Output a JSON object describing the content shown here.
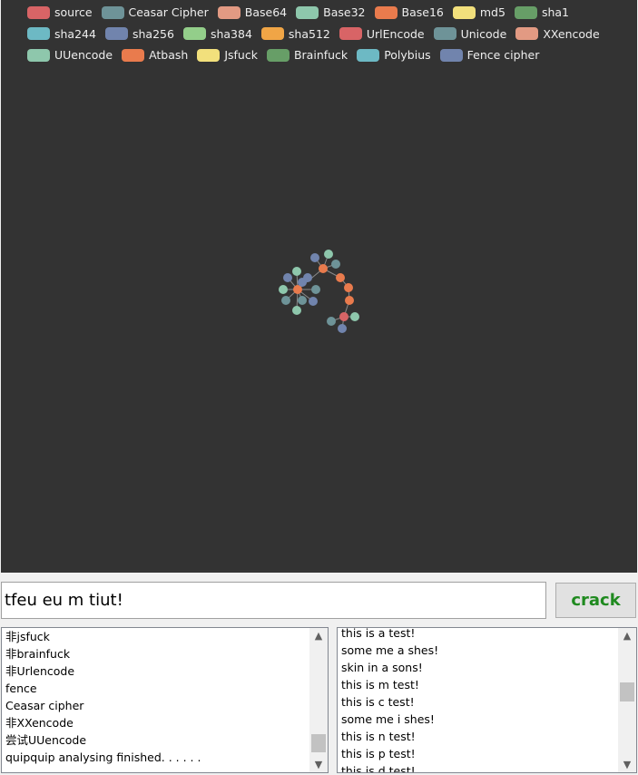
{
  "legend": [
    {
      "label": "source",
      "color": "#d86466"
    },
    {
      "label": "Ceasar Cipher",
      "color": "#6e9398"
    },
    {
      "label": "Base64",
      "color": "#e29a83"
    },
    {
      "label": "Base32",
      "color": "#8ec7ac"
    },
    {
      "label": "Base16",
      "color": "#e97b4d"
    },
    {
      "label": "md5",
      "color": "#f2e07c"
    },
    {
      "label": "sha1",
      "color": "#679e67"
    },
    {
      "label": "sha244",
      "color": "#6db9c4"
    },
    {
      "label": "sha256",
      "color": "#7184ad"
    },
    {
      "label": "sha384",
      "color": "#93ce8a"
    },
    {
      "label": "sha512",
      "color": "#f0a546"
    },
    {
      "label": "UrlEncode",
      "color": "#d86466"
    },
    {
      "label": "Unicode",
      "color": "#6e9398"
    },
    {
      "label": "XXencode",
      "color": "#e29a83"
    },
    {
      "label": "UUencode",
      "color": "#8ec7ac"
    },
    {
      "label": "Atbash",
      "color": "#e97b4d"
    },
    {
      "label": "Jsfuck",
      "color": "#f2e07c"
    },
    {
      "label": "Brainfuck",
      "color": "#679e67"
    },
    {
      "label": "Polybius",
      "color": "#6db9c4"
    },
    {
      "label": "Fence cipher",
      "color": "#7184ad"
    }
  ],
  "graph": {
    "nodes": [
      {
        "id": "a0",
        "color": "#e97b4d"
      },
      {
        "id": "a1",
        "color": "#8ec7ac"
      },
      {
        "id": "a2",
        "color": "#7184ad"
      },
      {
        "id": "a3",
        "color": "#7184ad"
      },
      {
        "id": "a4",
        "color": "#8ec7ac"
      },
      {
        "id": "a5",
        "color": "#6e9398"
      },
      {
        "id": "a6",
        "color": "#8ec7ac"
      },
      {
        "id": "a7",
        "color": "#6e9398"
      },
      {
        "id": "a8",
        "color": "#7184ad"
      },
      {
        "id": "a9",
        "color": "#6e9398"
      },
      {
        "id": "a10",
        "color": "#7184ad"
      },
      {
        "id": "b0",
        "color": "#e97b4d"
      },
      {
        "id": "b1",
        "color": "#7184ad"
      },
      {
        "id": "b2",
        "color": "#8ec7ac"
      },
      {
        "id": "b3",
        "color": "#6e9398"
      },
      {
        "id": "b4",
        "color": "#e97b4d"
      },
      {
        "id": "b5",
        "color": "#e97b4d"
      },
      {
        "id": "b6",
        "color": "#e97b4d"
      },
      {
        "id": "c0",
        "color": "#d86466"
      },
      {
        "id": "c1",
        "color": "#8ec7ac"
      },
      {
        "id": "c2",
        "color": "#6e9398"
      },
      {
        "id": "c3",
        "color": "#7184ad"
      }
    ],
    "links": [
      [
        "a0",
        "a1"
      ],
      [
        "a0",
        "a2"
      ],
      [
        "a0",
        "a3"
      ],
      [
        "a0",
        "a4"
      ],
      [
        "a0",
        "a5"
      ],
      [
        "a0",
        "a6"
      ],
      [
        "a0",
        "a7"
      ],
      [
        "a0",
        "a8"
      ],
      [
        "a0",
        "a9"
      ],
      [
        "a0",
        "a10"
      ],
      [
        "a0",
        "b0"
      ],
      [
        "b0",
        "b1"
      ],
      [
        "b0",
        "b2"
      ],
      [
        "b0",
        "b3"
      ],
      [
        "b0",
        "b4"
      ],
      [
        "b4",
        "b5"
      ],
      [
        "b5",
        "b6"
      ],
      [
        "b6",
        "c0"
      ],
      [
        "c0",
        "c1"
      ],
      [
        "c0",
        "c2"
      ],
      [
        "c0",
        "c3"
      ]
    ]
  },
  "input": {
    "value": "tfeu eu m tiut!"
  },
  "crack_button": {
    "label": "crack"
  },
  "log_list": {
    "lines": [
      "非jsfuck",
      "非brainfuck",
      "非Urlencode",
      "fence",
      "Ceasar cipher",
      "非XXencode",
      "尝试UUencode",
      "quipquip analysing finished. . . . . ."
    ]
  },
  "result_list": {
    "lines": [
      "this is a test!",
      "some me a shes!",
      "skin in a sons!",
      "this is m test!",
      "this is c test!",
      "some me i shes!",
      "this is n test!",
      "this is p test!",
      "this is d test!"
    ]
  },
  "icons": {
    "scroll_up": "▲",
    "scroll_down": "▼"
  }
}
